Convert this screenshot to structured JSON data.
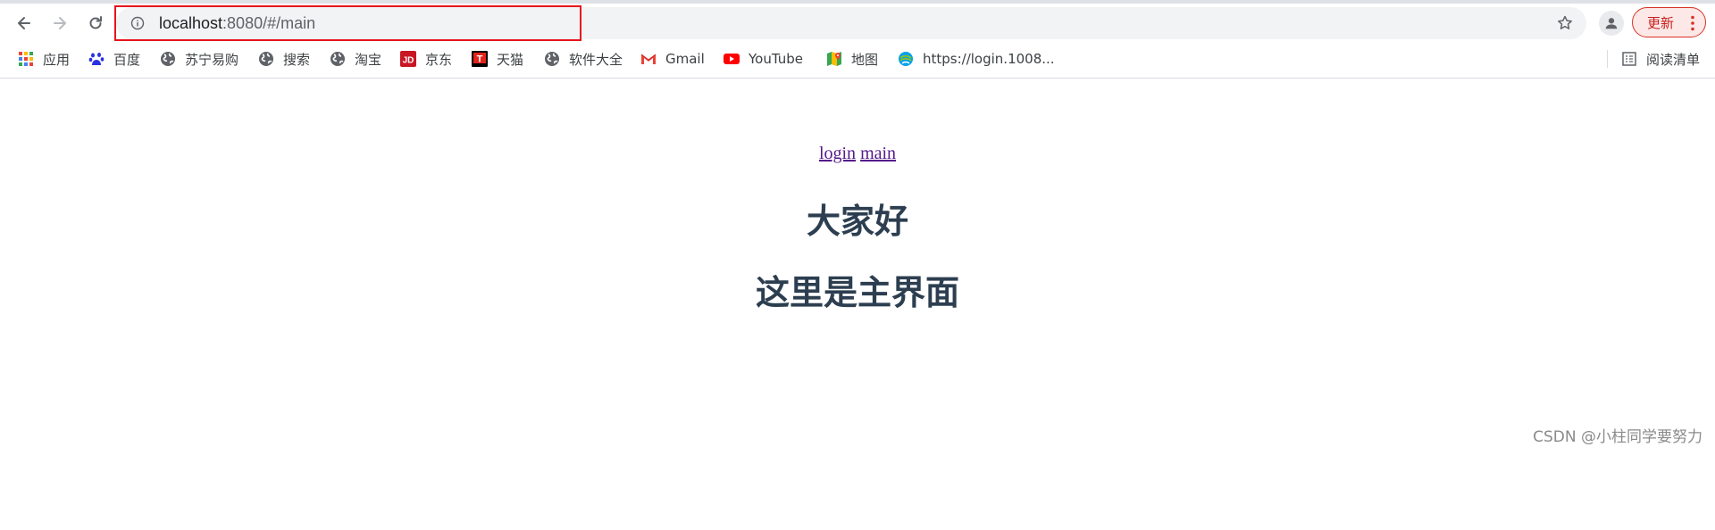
{
  "browser": {
    "url_host": "localhost",
    "url_rest": ":8080/#/main",
    "update_label": "更新",
    "reading_list_label": "阅读清单"
  },
  "bookmarks": [
    {
      "label": "应用",
      "icon": "apps-grid-icon"
    },
    {
      "label": "百度",
      "icon": "baidu-paw-icon"
    },
    {
      "label": "苏宁易购",
      "icon": "globe-icon"
    },
    {
      "label": "搜索",
      "icon": "globe-icon"
    },
    {
      "label": "淘宝",
      "icon": "globe-icon"
    },
    {
      "label": "京东",
      "icon": "jd-icon"
    },
    {
      "label": "天猫",
      "icon": "tmall-icon"
    },
    {
      "label": "软件大全",
      "icon": "globe-icon"
    },
    {
      "label": "Gmail",
      "icon": "gmail-icon"
    },
    {
      "label": "YouTube",
      "icon": "youtube-icon"
    },
    {
      "label": "地图",
      "icon": "maps-icon"
    },
    {
      "label": "https://login.1008...",
      "icon": "china-mobile-icon"
    }
  ],
  "page": {
    "links": [
      {
        "label": "login"
      },
      {
        "label": "main"
      }
    ],
    "heading_1": "大家好",
    "heading_2": "这里是主界面"
  },
  "watermark": "CSDN @小柱同学要努力",
  "colors": {
    "heading": "#2c3e50",
    "visited_link": "#551a8b",
    "highlight_border": "#e8141c",
    "update_red": "#d93025"
  }
}
